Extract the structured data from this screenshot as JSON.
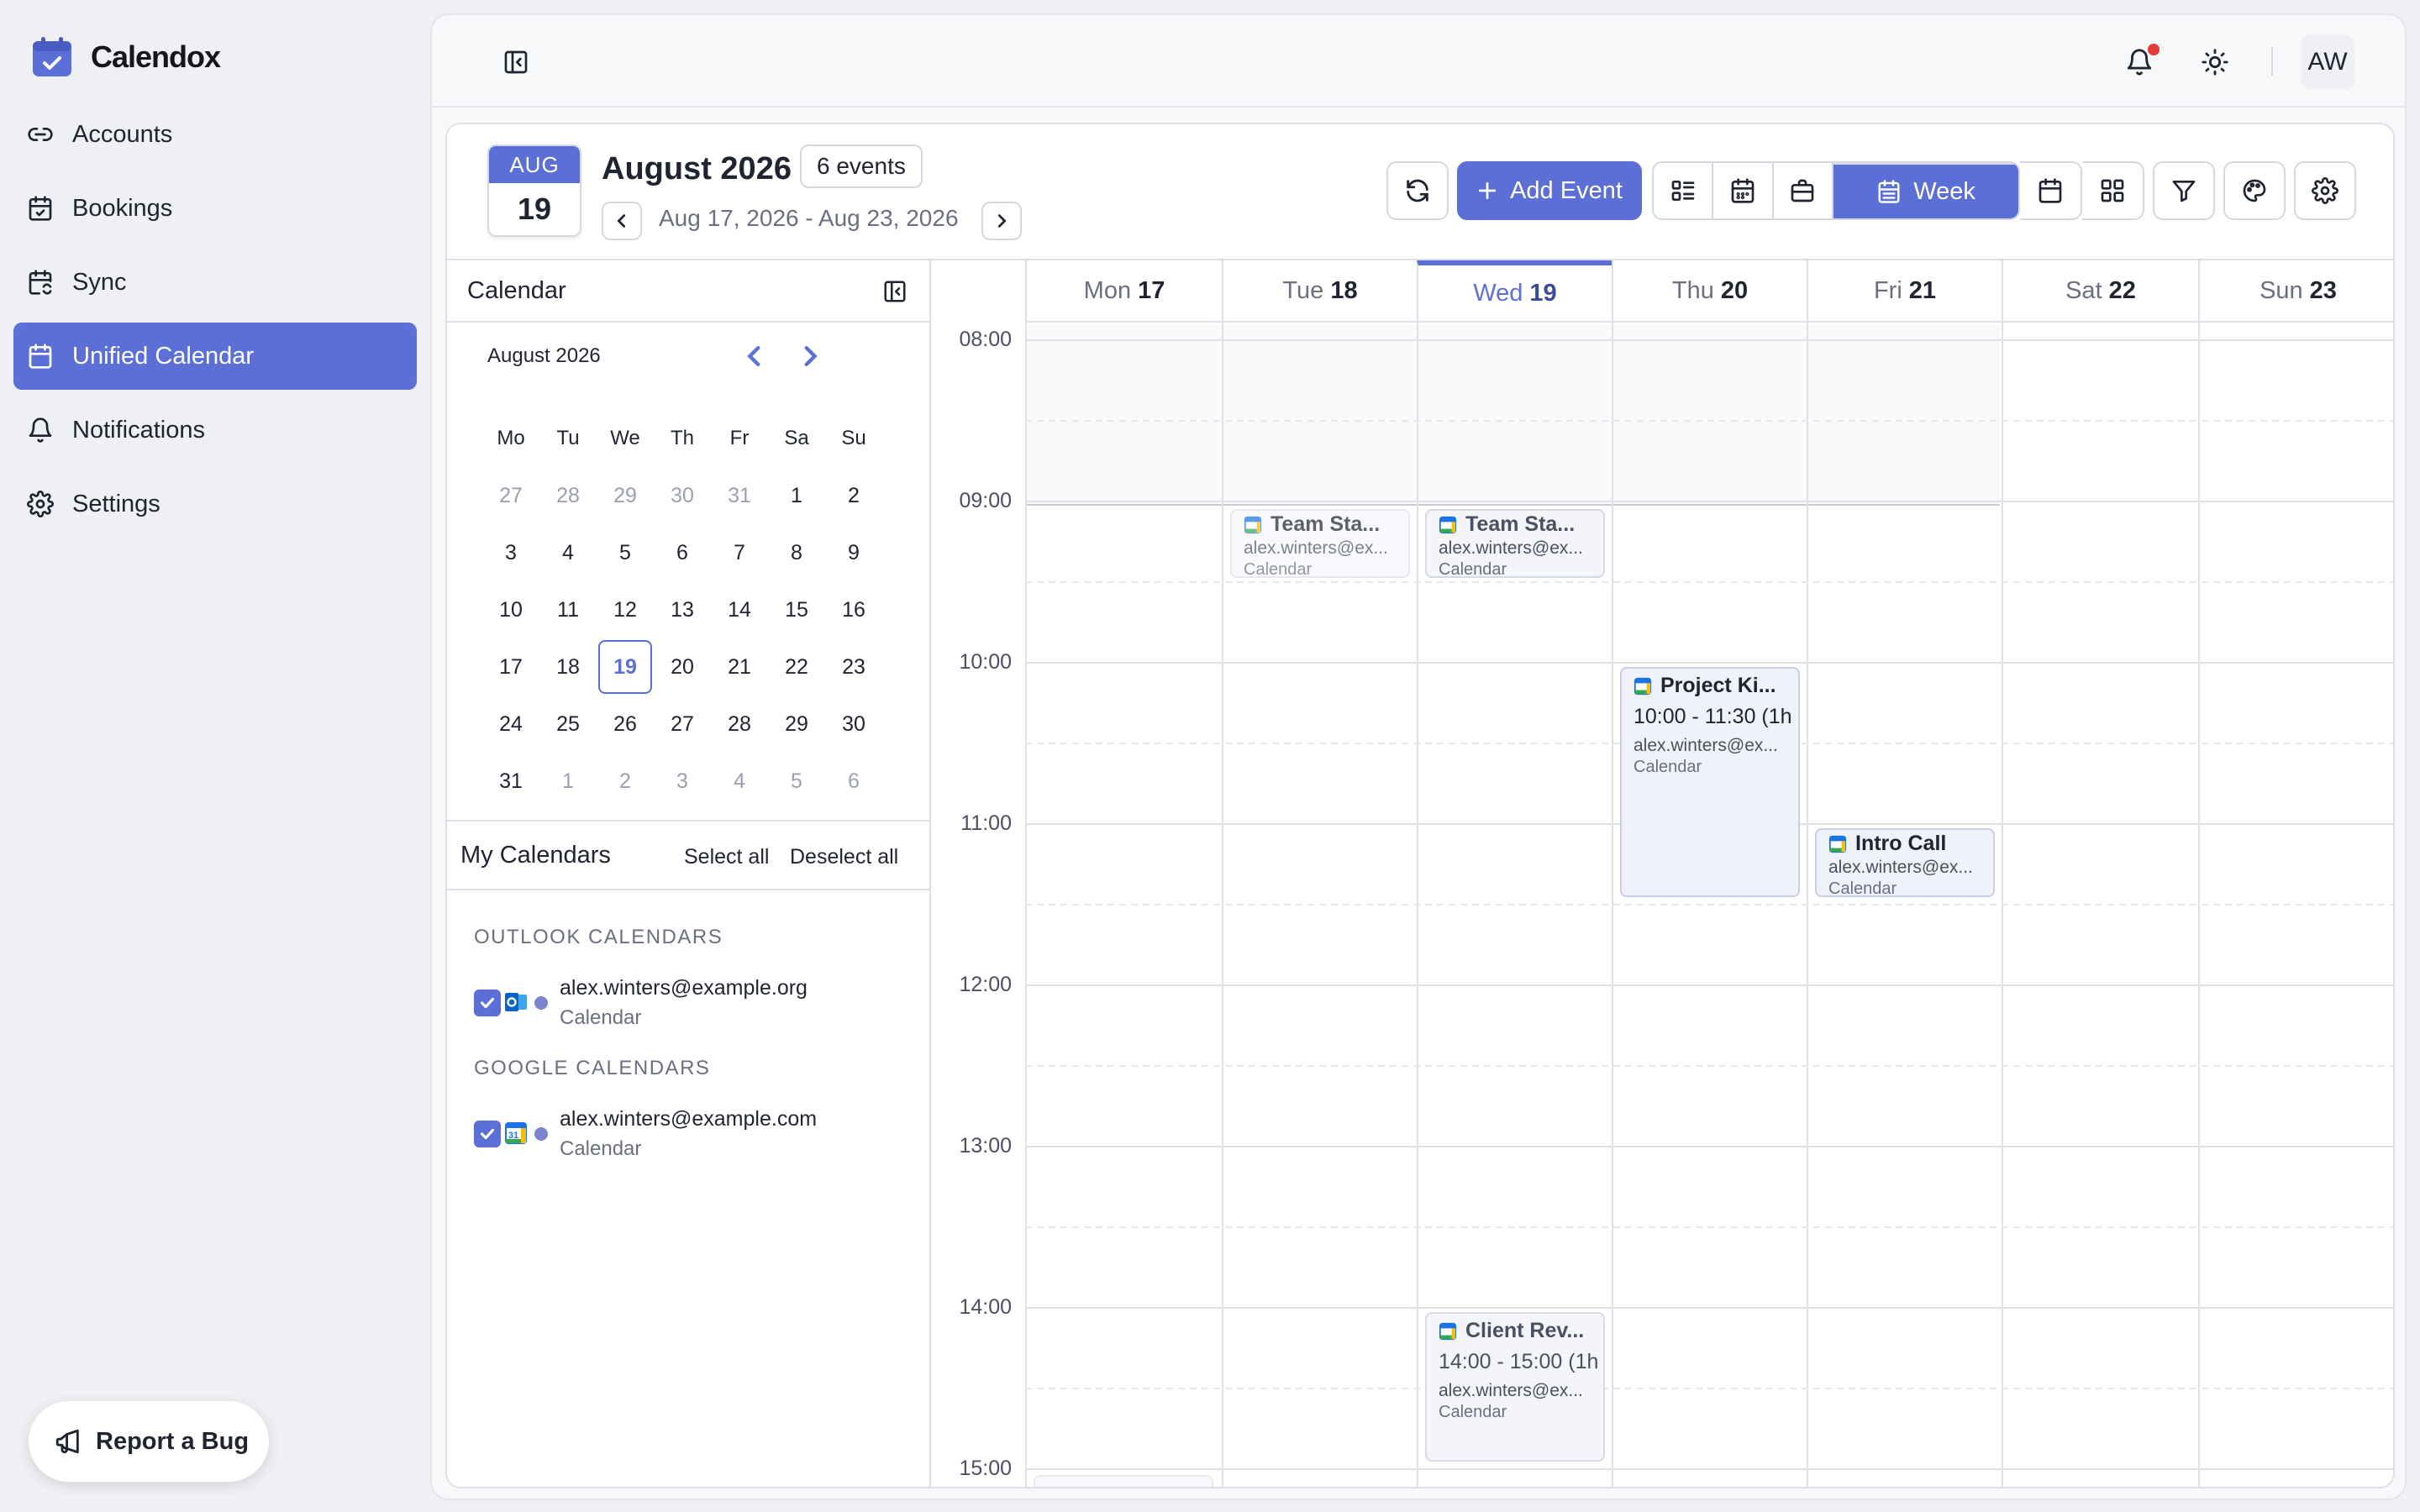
{
  "app": {
    "name": "Calendox"
  },
  "sidebar": {
    "items": [
      {
        "label": "Accounts",
        "icon": "link-icon"
      },
      {
        "label": "Bookings",
        "icon": "calendar-check-icon"
      },
      {
        "label": "Sync",
        "icon": "calendar-sync-icon"
      },
      {
        "label": "Unified Calendar",
        "icon": "calendar-icon",
        "active": true
      },
      {
        "label": "Notifications",
        "icon": "bell-icon"
      },
      {
        "label": "Settings",
        "icon": "gear-icon"
      }
    ],
    "report_bug": "Report a Bug"
  },
  "topbar": {
    "avatar": "AW",
    "has_notification": true
  },
  "header": {
    "badge_month": "AUG",
    "badge_day": "19",
    "title": "August 2026",
    "events_count": "6 events",
    "range": "Aug 17, 2026 - Aug 23, 2026",
    "add_event": "Add Event",
    "view_week": "Week"
  },
  "mini_calendar": {
    "panel_title": "Calendar",
    "month": "August 2026",
    "weekdays": [
      "Mo",
      "Tu",
      "We",
      "Th",
      "Fr",
      "Sa",
      "Su"
    ],
    "weeks": [
      [
        "27",
        "28",
        "29",
        "30",
        "31",
        "1",
        "2"
      ],
      [
        "3",
        "4",
        "5",
        "6",
        "7",
        "8",
        "9"
      ],
      [
        "10",
        "11",
        "12",
        "13",
        "14",
        "15",
        "16"
      ],
      [
        "17",
        "18",
        "19",
        "20",
        "21",
        "22",
        "23"
      ],
      [
        "24",
        "25",
        "26",
        "27",
        "28",
        "29",
        "30"
      ],
      [
        "31",
        "1",
        "2",
        "3",
        "4",
        "5",
        "6"
      ]
    ],
    "selected": "19"
  },
  "my_calendars": {
    "title": "My Calendars",
    "select_all": "Select all",
    "deselect_all": "Deselect all",
    "outlook_label": "OUTLOOK CALENDARS",
    "outlook_email": "alex.winters@example.org",
    "outlook_sub": "Calendar",
    "google_label": "GOOGLE CALENDARS",
    "google_email": "alex.winters@example.com",
    "google_sub": "Calendar"
  },
  "week": {
    "days": [
      {
        "name": "Mon",
        "num": "17"
      },
      {
        "name": "Tue",
        "num": "18"
      },
      {
        "name": "Wed",
        "num": "19",
        "today": true
      },
      {
        "name": "Thu",
        "num": "20"
      },
      {
        "name": "Fri",
        "num": "21"
      },
      {
        "name": "Sat",
        "num": "22"
      },
      {
        "name": "Sun",
        "num": "23"
      }
    ],
    "times": [
      "08:00",
      "09:00",
      "10:00",
      "11:00",
      "12:00",
      "13:00",
      "14:00",
      "15:00"
    ]
  },
  "events": {
    "e1": {
      "title": "Team Sta...",
      "email": "alex.winters@ex...",
      "cal": "Calendar"
    },
    "e2": {
      "title": "Team Sta...",
      "email": "alex.winters@ex...",
      "cal": "Calendar"
    },
    "e3": {
      "title": "Project Ki...",
      "time": "10:00 - 11:30 (1h",
      "email": "alex.winters@ex...",
      "cal": "Calendar"
    },
    "e4": {
      "title": "Intro Call",
      "email": "alex.winters@ex...",
      "cal": "Calendar"
    },
    "e5": {
      "title": "Client Rev...",
      "time": "14:00 - 15:00 (1h",
      "email": "alex.winters@ex...",
      "cal": "Calendar"
    }
  },
  "colors": {
    "accent": "#5b6fd6",
    "notification_dot": "#e53935"
  }
}
